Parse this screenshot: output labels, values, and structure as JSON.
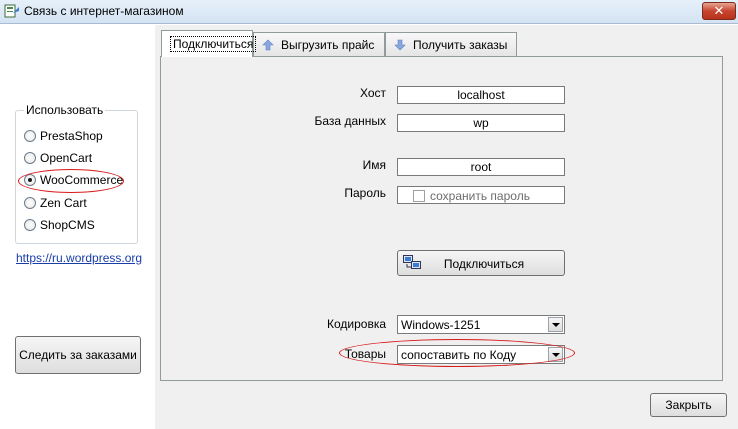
{
  "window": {
    "title": "Связь с интернет-магазином",
    "close_label": "✕"
  },
  "left": {
    "group_title": "Использовать",
    "options": [
      {
        "label": "PrestaShop",
        "checked": false
      },
      {
        "label": "OpenCart",
        "checked": false
      },
      {
        "label": "WooCommerce",
        "checked": true
      },
      {
        "label": "Zen Cart",
        "checked": false
      },
      {
        "label": "ShopCMS",
        "checked": false
      }
    ],
    "link": "https://ru.wordpress.org",
    "track_button": "Следить за заказами"
  },
  "tabs": [
    {
      "label": "Подключиться",
      "active": true,
      "icon": ""
    },
    {
      "label": "Выгрузить прайс",
      "active": false,
      "icon": "arrow-up-icon"
    },
    {
      "label": "Получить заказы",
      "active": false,
      "icon": "arrow-down-icon"
    }
  ],
  "form": {
    "host_label": "Хост",
    "host_value": "localhost",
    "db_label": "База данных",
    "db_value": "wp",
    "name_label": "Имя",
    "name_value": "root",
    "password_label": "Пароль",
    "password_value": "",
    "save_password_label": "сохранить пароль",
    "connect_button": "Подключиться",
    "encoding_label": "Кодировка",
    "encoding_value": "Windows-1251",
    "goods_label": "Товары",
    "goods_value": "сопоставить по Коду"
  },
  "footer": {
    "close_button": "Закрыть"
  },
  "colors": {
    "highlight": "#d81a1a",
    "arrow": "#8aa8e0"
  }
}
